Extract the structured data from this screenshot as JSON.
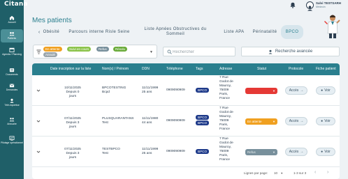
{
  "brand": "Citana",
  "sidebar": {
    "items": [
      {
        "label": "Accueil",
        "icon": "home-icon"
      },
      {
        "label": "Patients",
        "icon": "patients-icon",
        "active": true
      },
      {
        "label": "Agenda / Planning",
        "icon": "calendar-icon"
      },
      {
        "label": "Documents",
        "icon": "document-icon"
      },
      {
        "label": "Demandes",
        "icon": "mail-icon"
      },
      {
        "label": "Télé-expertise",
        "icon": "expert-icon"
      },
      {
        "label": "Annuaire",
        "icon": "directory-icon"
      },
      {
        "label": "Pilotage opérationnel",
        "icon": "dashboard-icon"
      }
    ]
  },
  "header": {
    "user_name": "Salvi TESTSARH",
    "user_role": "Médecin"
  },
  "page": {
    "title": "Mes patients",
    "tabs": [
      {
        "label": "Obésité",
        "back": true
      },
      {
        "label": "Parcours interne Risle Seine"
      },
      {
        "label": "Liste Apnées Obstructives du Sommeil"
      },
      {
        "label": "Liste APA"
      },
      {
        "label": "Périnatalité"
      },
      {
        "label": "BPCO",
        "active": true
      }
    ]
  },
  "filters": {
    "chips": [
      {
        "label": "En attente",
        "color": "#f0a020"
      },
      {
        "label": "Suivi en cours",
        "color": "#8bc34a"
      },
      {
        "label": "Refus",
        "color": "#78909c"
      },
      {
        "label": "Résolu",
        "color": "#6aab3a"
      },
      {
        "label": "Annulé",
        "color": "#9aa5ab"
      }
    ],
    "search_placeholder": "Rechercher",
    "advanced_label": "Recherche avancée"
  },
  "table": {
    "headers": [
      "Date inscription sur la liste",
      "Nom(s) / Prénom",
      "DDN",
      "Téléphone",
      "Tags",
      "Adresse",
      "Statut",
      "Protocole",
      "Fiche patient"
    ],
    "rows": [
      {
        "date": "10/11/2025",
        "since": "Depuis 0 jours",
        "lastname": "BPCOTESTING",
        "firstname": "Bcpd",
        "ddn": "11/11/1999",
        "age": "25 ans",
        "phone": "0909090909",
        "tags": [
          "BPCO"
        ],
        "address": "7 Rue Godot de Mauroy, 75009 Paris, France",
        "status": "",
        "status_color": "#e53935",
        "protocol": "Accès",
        "fiche": "Voir"
      },
      {
        "date": "07/11/2025",
        "since": "Depuis 3 jours",
        "lastname": "PLUSQUARANTANS",
        "firstname": "Test",
        "ddn": "11/11/1980",
        "age": "44 ans",
        "phone": "0909090909",
        "tags": [
          "BPCO",
          "BPCO"
        ],
        "address": "7 Rue Godot de Mauroy, 75009 Paris, France",
        "status": "En attente",
        "status_color": "#f0a020",
        "protocol": "Accès",
        "fiche": "Voir"
      },
      {
        "date": "07/11/2025",
        "since": "Depuis 3 jours",
        "lastname": "TESTBPCO",
        "firstname": "Test",
        "ddn": "11/11/1999",
        "age": "25 ans",
        "phone": "0909090909",
        "tags": [
          "BPCO"
        ],
        "address": "7 Rue Godot de Mauroy, 75009 Paris, France",
        "status": "Refus",
        "status_color": "#78909c",
        "protocol": "Accès",
        "fiche": "Voir"
      }
    ],
    "pagination": {
      "rows_per_page_label": "Lignes par page:",
      "rows_per_page": "10",
      "range": "1-3 sur 3"
    }
  }
}
